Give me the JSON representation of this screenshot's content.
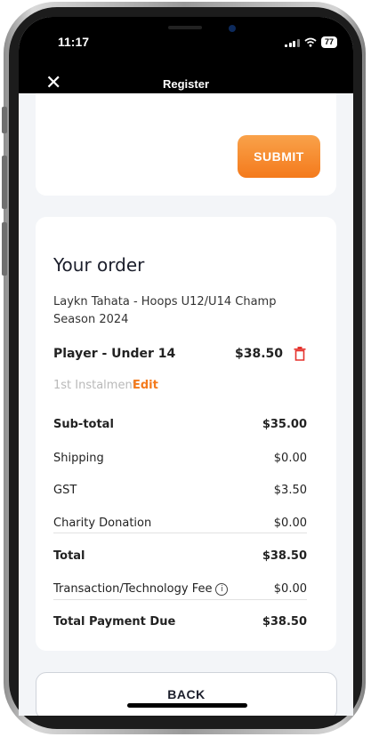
{
  "status_bar": {
    "time": "11:17",
    "battery": "77",
    "icons": [
      "signal-icon",
      "wifi-icon",
      "battery-icon"
    ]
  },
  "header": {
    "title": "Register",
    "close_icon": "close-icon"
  },
  "actions": {
    "submit_label": "SUBMIT",
    "back_label": "BACK"
  },
  "order": {
    "title": "Your order",
    "event": "Laykn Tahata - Hoops U12/U14 Champ Season 2024",
    "item": {
      "name": "Player - Under 14",
      "price": "$38.50",
      "instalment": "1st Instalment",
      "edit_label": "Edit"
    },
    "lines": {
      "subtotal_label": "Sub-total",
      "subtotal_value": "$35.00",
      "shipping_label": "Shipping",
      "shipping_value": "$0.00",
      "gst_label": "GST",
      "gst_value": "$3.50",
      "charity_label": "Charity Donation",
      "charity_value": "$0.00",
      "total_label": "Total",
      "total_value": "$38.50",
      "fee_label": "Transaction/Technology Fee",
      "fee_value": "$0.00",
      "due_label": "Total Payment Due",
      "due_value": "$38.50"
    }
  },
  "colors": {
    "accent": "#f47a1c",
    "delete": "#e5322d",
    "background": "#f3f5f8"
  }
}
